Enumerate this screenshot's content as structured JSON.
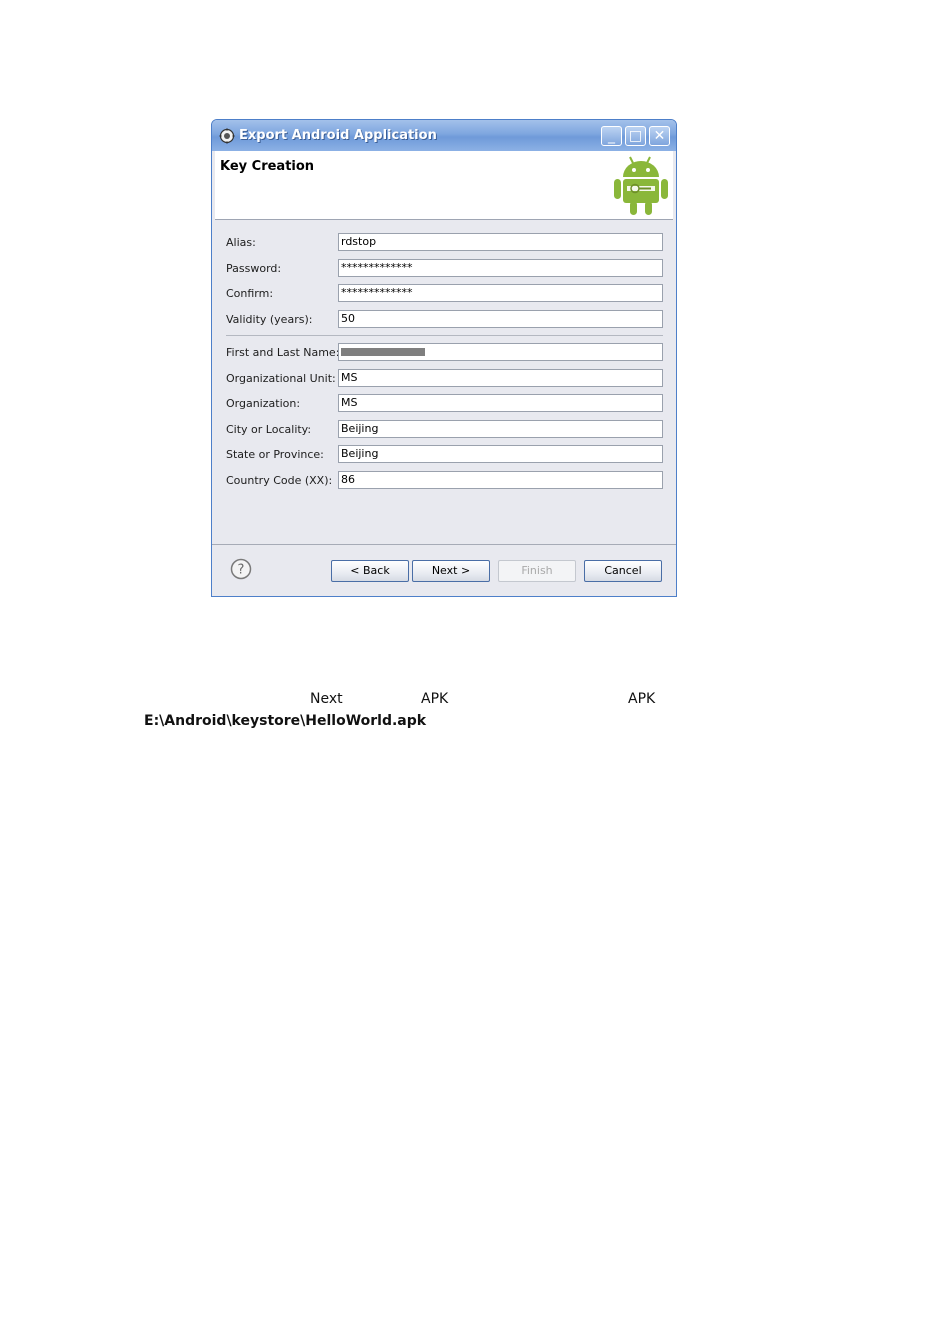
{
  "window": {
    "title": "Export Android Application",
    "minimize_label": "_",
    "maximize_label": "□",
    "close_label": "✕"
  },
  "header": {
    "title": "Key Creation"
  },
  "form": {
    "fields": [
      {
        "label": "Alias:",
        "value": "rdstop"
      },
      {
        "label": "Password:",
        "value": "*************"
      },
      {
        "label": "Confirm:",
        "value": "*************"
      },
      {
        "label": "Validity (years):",
        "value": "50"
      },
      {
        "label": "First and Last Name:",
        "value": ""
      },
      {
        "label": "Organizational Unit:",
        "value": "MS"
      },
      {
        "label": "Organization:",
        "value": "MS"
      },
      {
        "label": "City or Locality:",
        "value": "Beijing"
      },
      {
        "label": "State or Province:",
        "value": "Beijing"
      },
      {
        "label": "Country Code (XX):",
        "value": "86"
      }
    ]
  },
  "buttons": {
    "back": "< Back",
    "next": "Next >",
    "finish": "Finish",
    "cancel": "Cancel"
  },
  "caption": {
    "next_word": "Next",
    "apk_1": "APK",
    "apk_2": "APK",
    "path": "E:\\Android\\keystore\\HelloWorld.apk"
  }
}
